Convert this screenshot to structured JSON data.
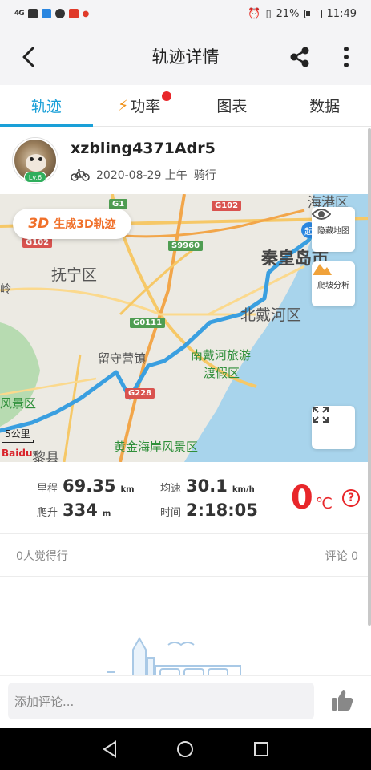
{
  "status_bar": {
    "signal": "4G",
    "battery": "21%",
    "time": "11:49"
  },
  "header": {
    "title": "轨迹详情"
  },
  "tabs": [
    {
      "label": "轨迹",
      "active": true
    },
    {
      "label": "功率",
      "has_dot": true,
      "icon": "lightning-icon"
    },
    {
      "label": "图表"
    },
    {
      "label": "数据"
    }
  ],
  "profile": {
    "username": "xzbling4371Adr5",
    "level": "Lv.6",
    "date": "2020-08-29 上午",
    "activity": "骑行"
  },
  "map": {
    "btn_3d_prefix": "3D",
    "btn_3d_label": "生成3D轨迹",
    "hide_map_label": "隐藏地图",
    "climb_label": "爬坡分析",
    "scale": "5公里",
    "logo": "Baidu",
    "places": {
      "funing": "抚宁区",
      "qinhuangdao": "秦皇岛市",
      "beidaihe": "北戴河区",
      "liushouying": "留守营镇",
      "nandaihe": "南戴河旅游",
      "dujia": "渡假区",
      "huangjin": "黄金海岸风景区",
      "fengjing": "风景区",
      "changli": "黎县",
      "haigang": "海港区",
      "ling": "岭"
    },
    "highways": [
      "G1",
      "G102",
      "G102",
      "S9960",
      "G0111",
      "G228"
    ]
  },
  "stats": {
    "distance_label": "里程",
    "distance_value": "69.35",
    "distance_unit": "km",
    "speed_label": "均速",
    "speed_value": "30.1",
    "speed_unit": "km/h",
    "climb_label": "爬升",
    "climb_value": "334",
    "climb_unit": "m",
    "time_label": "时间",
    "time_value": "2:18:05",
    "temperature_value": "0",
    "temperature_unit": "℃"
  },
  "social": {
    "likes": "0人觉得行",
    "comments": "评论 0"
  },
  "comment_bar": {
    "placeholder": "添加评论..."
  },
  "colors": {
    "accent": "#1aa0d8",
    "orange": "#f0702a",
    "red": "#e8262a",
    "route": "#3a9fe0"
  }
}
